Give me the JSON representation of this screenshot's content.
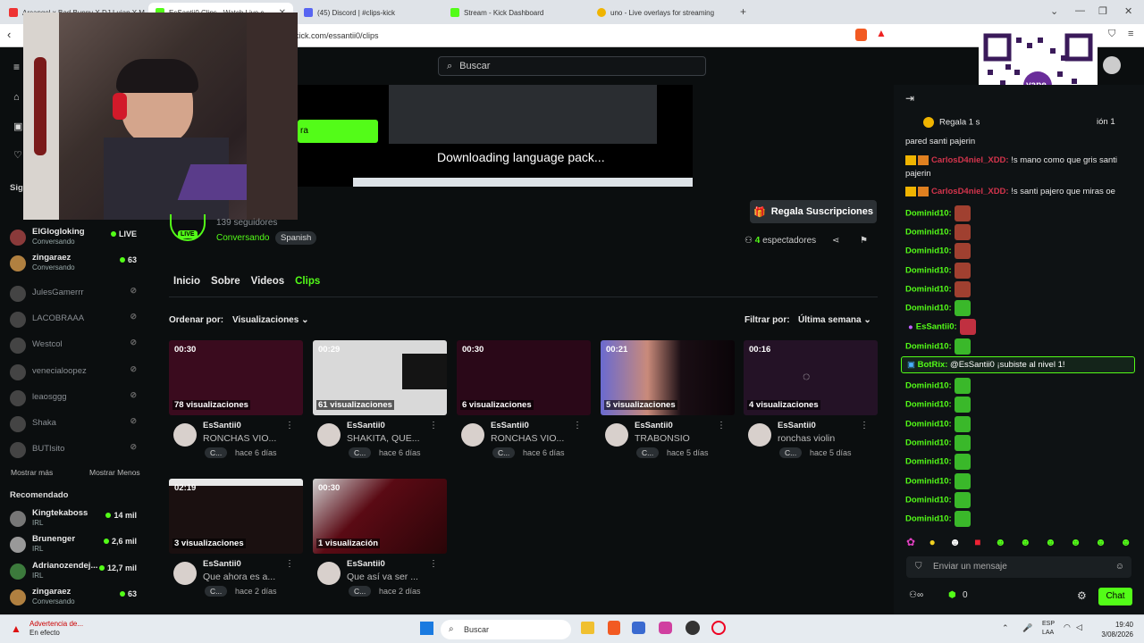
{
  "browser": {
    "tabs": [
      {
        "label": "Arcangel x Bad Bunny X DJ Luian X M..."
      },
      {
        "label": "EsSantii0 Clips - Watch Live c..."
      },
      {
        "label": "(45) Discord | #clips-kick"
      },
      {
        "label": "Stream - Kick Dashboard"
      },
      {
        "label": "uno - Live overlays for streaming"
      }
    ],
    "url": "kick.com/essantii0/clips"
  },
  "kick": {
    "search_placeholder": "Buscar",
    "preview_text": "Downloading language pack...",
    "green_button_label": "ra"
  },
  "sidebar": {
    "section_label": "Sig",
    "following": [
      {
        "name": "ElGlogloking",
        "sub": "Conversando",
        "count": "LIVE",
        "live": true
      },
      {
        "name": "zingaraez",
        "sub": "Conversando",
        "count": "63",
        "live": true
      },
      {
        "name": "JulesGamerrr",
        "sub": "",
        "count": "",
        "live": false
      },
      {
        "name": "LACOBRAAA",
        "sub": "",
        "count": "",
        "live": false
      },
      {
        "name": "Westcol",
        "sub": "",
        "count": "",
        "live": false
      },
      {
        "name": "venecialoopez",
        "sub": "",
        "count": "",
        "live": false
      },
      {
        "name": "leaosggg",
        "sub": "",
        "count": "",
        "live": false
      },
      {
        "name": "Shaka",
        "sub": "",
        "count": "",
        "live": false
      },
      {
        "name": "BUTIsito",
        "sub": "",
        "count": "",
        "live": false
      }
    ],
    "show_more": "Mostrar más",
    "show_less": "Mostrar Menos",
    "recommended_label": "Recomendado",
    "recommended": [
      {
        "name": "Kingtekaboss",
        "sub": "IRL",
        "count": "14 mil"
      },
      {
        "name": "Brunenger",
        "sub": "IRL",
        "count": "2,6 mil"
      },
      {
        "name": "Adrianozendej...",
        "sub": "IRL",
        "count": "12,7 mil"
      },
      {
        "name": "zingaraez",
        "sub": "Conversando",
        "count": "63"
      }
    ]
  },
  "channel": {
    "followers": "139 seguidores",
    "category": "Conversando",
    "language": "Spanish",
    "live_badge": "LIVE",
    "subs_button": "Regala Suscripciones",
    "viewers_count": "4",
    "viewers_label": "espectadores",
    "tabs": [
      "Inicio",
      "Sobre",
      "Videos",
      "Clips"
    ],
    "sort_label": "Ordenar por:",
    "sort_value": "Visualizaciones",
    "filter_label": "Filtrar por:",
    "filter_value": "Última semana"
  },
  "clips": [
    {
      "duration": "00:30",
      "views": "78 visualizaciones",
      "author": "EsSantii0",
      "title": "RONCHAS VIO...",
      "cat": "C...",
      "ago": "hace 6 días",
      "color": "#3a0b1e"
    },
    {
      "duration": "00:29",
      "views": "61 visualizaciones",
      "author": "EsSantii0",
      "title": "SHAKITA, QUE...",
      "cat": "C...",
      "ago": "hace 6 días",
      "color": "#d9d9d9"
    },
    {
      "duration": "00:30",
      "views": "6 visualizaciones",
      "author": "EsSantii0",
      "title": "RONCHAS VIO...",
      "cat": "C...",
      "ago": "hace 6 días",
      "color": "#2a0818"
    },
    {
      "duration": "00:21",
      "views": "5 visualizaciones",
      "author": "EsSantii0",
      "title": "TRABONSIO",
      "cat": "C...",
      "ago": "hace 5 días",
      "color": "#5a4570"
    },
    {
      "duration": "00:16",
      "views": "4 visualizaciones",
      "author": "EsSantii0",
      "title": "ronchas violin",
      "cat": "C...",
      "ago": "hace 5 días",
      "color": "#241226"
    },
    {
      "duration": "02:19",
      "views": "3 visualizaciones",
      "author": "EsSantii0",
      "title": "Que ahora es a...",
      "cat": "C...",
      "ago": "hace 2 días",
      "color": "#1a1010"
    },
    {
      "duration": "00:30",
      "views": "1 visualización",
      "author": "EsSantii0",
      "title": "Que así va ser ...",
      "cat": "C...",
      "ago": "hace 2 días",
      "color": "#5a0a14"
    }
  ],
  "chat": {
    "messages": [
      {
        "user": "",
        "text": "Regala 1 s",
        "tail": "ión 1",
        "style": "gift"
      },
      {
        "user": "",
        "text": "pared santi pajerin",
        "style": "plain"
      },
      {
        "user": "CarlosD4niel_XDD:",
        "text": "!s mano como que gris santi",
        "style": "red"
      },
      {
        "user": "",
        "text": "pajerin",
        "style": "plain"
      },
      {
        "user": "CarlosD4niel_XDD:",
        "text": "!s santi pajero que miras oe",
        "style": "red"
      },
      {
        "user": "Dominid10:",
        "text": "",
        "style": "emote-red"
      },
      {
        "user": "Dominid10:",
        "text": "",
        "style": "emote-red"
      },
      {
        "user": "Dominid10:",
        "text": "",
        "style": "emote-red"
      },
      {
        "user": "Dominid10:",
        "text": "",
        "style": "emote-red"
      },
      {
        "user": "Dominid10:",
        "text": "",
        "style": "emote-red"
      },
      {
        "user": "Dominid10:",
        "text": "",
        "style": "emote-green"
      },
      {
        "user": "EsSantii0:",
        "text": "",
        "style": "emote-pink"
      },
      {
        "user": "Dominid10:",
        "text": "",
        "style": "emote-green"
      },
      {
        "user": "Dominid10:",
        "text": "",
        "style": "emote-green"
      },
      {
        "user": "Dominid10:",
        "text": "",
        "style": "emote-green"
      },
      {
        "user": "Dominid10:",
        "text": "",
        "style": "emote-green"
      },
      {
        "user": "Dominid10:",
        "text": "",
        "style": "emote-green"
      },
      {
        "user": "Dominid10:",
        "text": "",
        "style": "emote-green"
      },
      {
        "user": "Dominid10:",
        "text": "",
        "style": "emote-green"
      },
      {
        "user": "Dominid10:",
        "text": "",
        "style": "emote-green"
      },
      {
        "user": "Dominid10:",
        "text": "",
        "style": "emote-green"
      }
    ],
    "botrix_user": "BotRix:",
    "botrix_text": "@EsSantii0 ¡subiste al nivel 1!",
    "input_placeholder": "Enviar un mensaje",
    "points": "0",
    "chat_button": "Chat"
  },
  "qr": {
    "brand": "yape"
  },
  "taskbar": {
    "warning_title": "Advertencia de...",
    "warning_sub": "En efecto",
    "search": "Buscar",
    "lang1": "ESP",
    "lang2": "LAA",
    "time": "19:40",
    "date": "3/08/2026"
  },
  "colors": {
    "kick_green": "#53fc18",
    "bg": "#0b0e0f",
    "chat_red": "#d3344c"
  }
}
